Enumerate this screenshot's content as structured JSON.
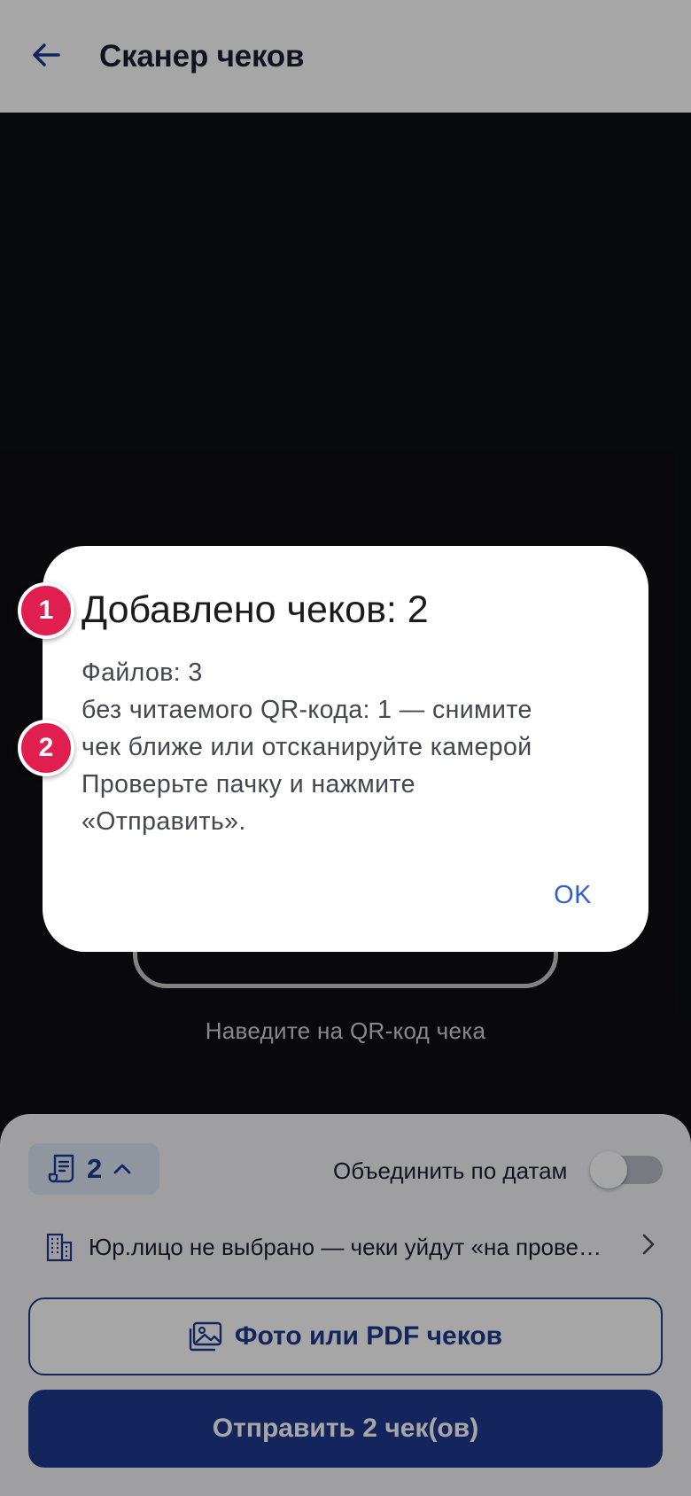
{
  "app_bar": {
    "title": "Сканер чеков",
    "back_icon": "arrow-left-icon"
  },
  "camera": {
    "hint": "Наведите на QR-код чека"
  },
  "bottom_sheet": {
    "count_chip": {
      "count": "2",
      "icon": "receipt-icon",
      "chevron": "chevron-up-icon"
    },
    "merge_by_dates": {
      "label": "Объединить по датам",
      "enabled": false
    },
    "legal_entity": {
      "icon": "building-icon",
      "text": "Юр.лицо не выбрано — чеки уйдут «на проверку»",
      "chevron": "chevron-right-icon"
    },
    "photo_button": {
      "label": "Фото или PDF чеков",
      "icon": "image-icon"
    },
    "send_button": {
      "label": "Отправить 2 чек(ов)"
    }
  },
  "dialog": {
    "title": "Добавлено чеков: 2",
    "body_lines": [
      "Файлов: 3",
      "без читаемого QR-кода: 1 — снимите",
      "чек ближе или отсканируйте камерой",
      "Проверьте пачку и нажмите",
      "«Отправить»."
    ],
    "ok_label": "OK"
  },
  "markers": [
    "1",
    "2"
  ],
  "colors": {
    "primary": "#1f3a8f",
    "chip_bg": "#dde6f6",
    "marker": "#e01e4f",
    "dialog_action": "#2f5fcf"
  }
}
